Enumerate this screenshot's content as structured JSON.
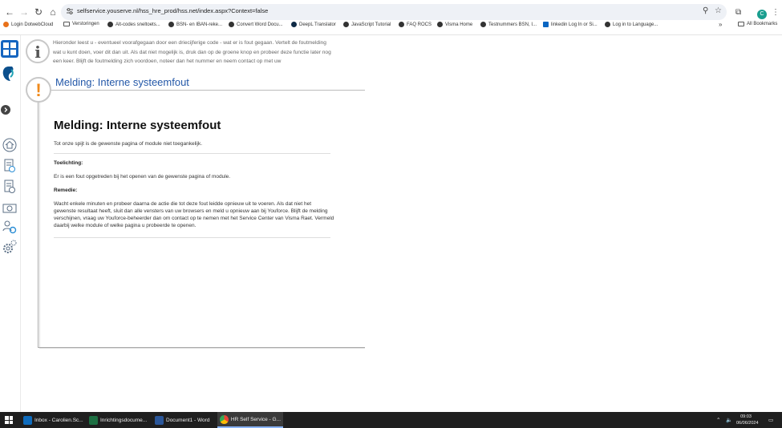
{
  "browser": {
    "url": "selfservice.youserve.nl/hss_hre_prod/hss.net/index.aspx?Context=false",
    "profile_initial": "C",
    "bookmarks": [
      {
        "label": "Login DotwebCloud",
        "color": "#e8711a"
      },
      {
        "label": "Verstoringen",
        "color": "folder"
      },
      {
        "label": "Alt-codes sneltoets...",
        "color": "#333333"
      },
      {
        "label": "BSN- en IBAN-reke...",
        "color": "#333333"
      },
      {
        "label": "Convert Word Docu...",
        "color": "#333333"
      },
      {
        "label": "DeepL Translator",
        "color": "#0f2b46"
      },
      {
        "label": "JavaScript Tutorial",
        "color": "#333333"
      },
      {
        "label": "FAQ ROCS",
        "color": "#333333"
      },
      {
        "label": "Visma Home",
        "color": "#333333"
      },
      {
        "label": "Testnummers BSN, I...",
        "color": "#333333"
      },
      {
        "label": "linkedin Log In or Si...",
        "color": "#0a66c2"
      },
      {
        "label": "Log in to Language...",
        "color": "#333333"
      }
    ],
    "all_bookmarks": "All Bookmarks",
    "more": "»"
  },
  "page": {
    "intro": "Hieronder leest u - eventueel voorafgegaan door een driecijferige code - wat er is fout gegaan. Vertelt de foutmelding wat u kunt doen, voer dit dan uit. Als dat niet mogelijk is, druk dan op de groene knop en probeer deze functie later nog een keer. Blijft de foutmelding zich voordoen, noteer dan het nummer en neem contact op met uw",
    "heading": "Melding: Interne systeemfout",
    "message_title": "Melding: Interne systeemfout",
    "message_sub": "Tot onze spijt is de gewenste pagina of module niet toegankelijk.",
    "toelichting_label": "Toelichting:",
    "toelichting_text": "Er is een fout opgetreden bij het openen van de gewenste pagina of module.",
    "remedie_label": "Remedie:",
    "remedie_text": "Wacht enkele minuten en probeer daarna de actie die tot deze fout leidde opnieuw uit te voeren. Als dat niet het gewenste resultaat heeft, sluit dan alle vensters van uw browsers en meld u opnieuw aan bij Youforce. Blijft de melding verschijnen, vraag uw Youforce-beheerder dan om contact op te nemen met het Service Center van Visma Raet. Vermeld daarbij welke module of welke pagina u probeerde te openen."
  },
  "taskbar": {
    "items": [
      {
        "label": "Inbox - Carolien.Sc...",
        "color": "#0f6cbd",
        "active": false
      },
      {
        "label": "Inrichtingsdocume...",
        "color": "#1d6f42",
        "active": false
      },
      {
        "label": "Document1 - Word",
        "color": "#2b579a",
        "active": false
      },
      {
        "label": "HR Self Service - G...",
        "color": "#e8453c",
        "active": true
      }
    ],
    "time": "09:03",
    "date": "06/06/2024"
  }
}
